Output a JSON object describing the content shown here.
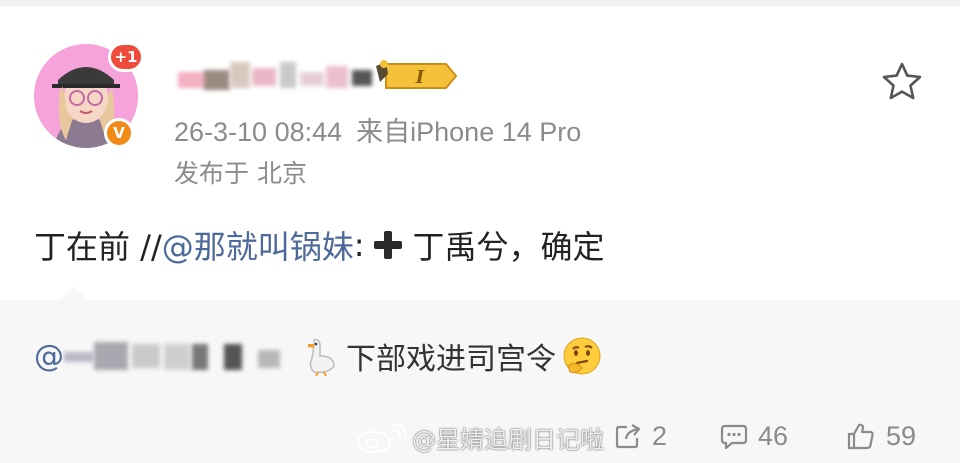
{
  "post": {
    "avatar_badge": "+1",
    "verified_badge": "V",
    "level_badge": "I",
    "timestamp": "26-3-10 08:44",
    "source": "来自iPhone 14 Pro",
    "location": "发布于 北京",
    "text_prefix": "丁在前 //",
    "mention": "@那就叫锅妹",
    "text_suffix": "丁禹兮，确定",
    "colon": ":"
  },
  "repost": {
    "at_sign": "@",
    "text": "下部戏进司宫令"
  },
  "watermark": {
    "text": "@星婧追剧日记啦"
  },
  "actions": {
    "share_count": "2",
    "comment_count": "46",
    "like_count": "59"
  },
  "icons": {
    "favorite": "star-icon",
    "share": "share-icon",
    "comment": "comment-icon",
    "like": "thumbs-up-icon",
    "repost_emoji": "goose-icon",
    "thinking_emoji": "thinking-face-icon"
  },
  "colors": {
    "mention": "#4e6a9a",
    "meta_gray": "#8b8b8b",
    "badge_red": "#ef4b3c",
    "badge_orange": "#f28a17",
    "repost_bg": "#f7f7f7"
  }
}
